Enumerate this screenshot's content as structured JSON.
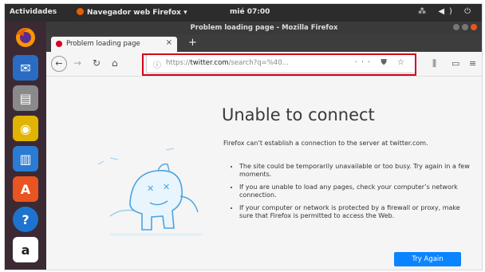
{
  "topbar": {
    "activities": "Actividades",
    "app_name": "Navegador web Firefox",
    "clock": "mié 07:00",
    "status_icons": "⁂ ◀) ⏻"
  },
  "window": {
    "title": "Problem loading page - Mozilla Firefox"
  },
  "tabs": [
    {
      "label": "Problem loading page",
      "close": "×"
    }
  ],
  "new_tab": "+",
  "nav": {
    "back": "←",
    "forward": "→",
    "reload": "↻",
    "home": "⌂",
    "url_prefix": "https://",
    "url_domain": "twitter.com",
    "url_path": "/search?q=%40...",
    "url_actions": "··· ⛊ ☆",
    "library": "⫼",
    "sidebar": "▭",
    "menu": "≡"
  },
  "error": {
    "heading": "Unable to connect",
    "description": "Firefox can’t establish a connection to the server at twitter.com.",
    "bullets": [
      "The site could be temporarily unavailable or too busy. Try again in a few moments.",
      "If you are unable to load any pages, check your computer’s network connection.",
      "If your computer or network is protected by a firewall or proxy, make sure that Firefox is permitted to access the Web."
    ],
    "retry_label": "Try Again"
  },
  "launcher": {
    "apps": [
      {
        "name": "firefox-icon",
        "glyph": "",
        "color": "#e66000"
      },
      {
        "name": "thunderbird-icon",
        "glyph": "✉",
        "color": "#2a6cc4"
      },
      {
        "name": "files-icon",
        "glyph": "▤",
        "color": "#8a8a8a"
      },
      {
        "name": "rhythmbox-icon",
        "glyph": "◉",
        "color": "#e0b400"
      },
      {
        "name": "writer-icon",
        "glyph": "▥",
        "color": "#2a7bd4"
      },
      {
        "name": "software-center-icon",
        "glyph": "A",
        "color": "#e95420"
      },
      {
        "name": "help-icon",
        "glyph": "?",
        "color": "#1d74d0"
      },
      {
        "name": "amazon-icon",
        "glyph": "a",
        "color": "#222222"
      }
    ]
  },
  "colors": {
    "highlight": "#d0021b",
    "accent": "#0a84ff",
    "launcher_bg": "#3b2a34"
  }
}
